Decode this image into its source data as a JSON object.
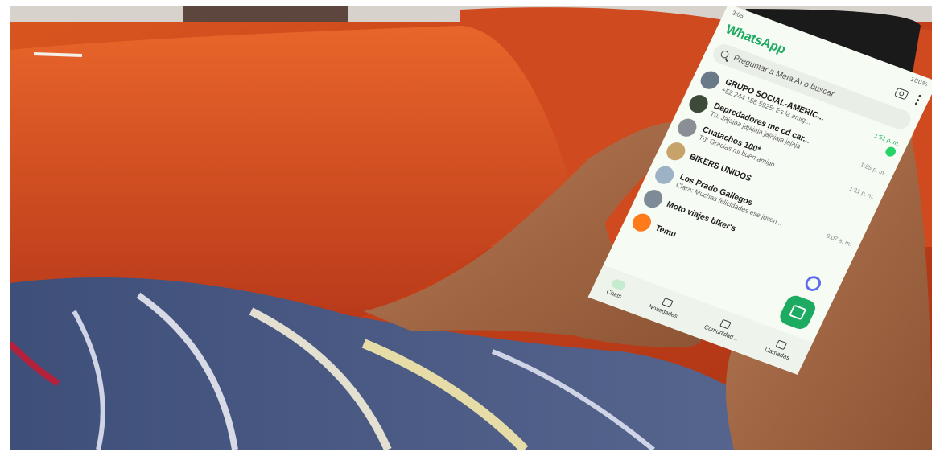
{
  "phone": {
    "statusbar": {
      "time": "3:05",
      "battery": "100%"
    },
    "app_title": "WhatsApp",
    "search_placeholder": "Preguntar a Meta AI o buscar",
    "chats": [
      {
        "name": "GRUPO SOCIAL-AMERIC...",
        "preview": "+52 244 158 5925: Es la amig...",
        "time": "1:51 p. m.",
        "unread": true,
        "avatar_color": "#6b7a88"
      },
      {
        "name": "Depredadores mc cd car...",
        "preview": "Tú: Jajajaa jajajaja jajajaja jajaja",
        "time": "1:25 p. m.",
        "unread": false,
        "avatar_color": "#3d4a3a"
      },
      {
        "name": "Cuatachos 100*",
        "preview": "Tú: Gracias mi buen amigo",
        "time": "1:11 p. m.",
        "unread": false,
        "avatar_color": "#8a8f95"
      },
      {
        "name": "BIKERS UNIDOS",
        "preview": "",
        "time": "",
        "unread": false,
        "avatar_color": "#c7a36b"
      },
      {
        "name": "Los Prado Gallegos",
        "preview": "Clara: Muchas felicidades ese joven...",
        "time": "9:07 a. m.",
        "unread": false,
        "avatar_color": "#9db2c4"
      },
      {
        "name": "Moto viajes biker's",
        "preview": "",
        "time": "",
        "unread": false,
        "avatar_color": "#7e8a96"
      },
      {
        "name": "Temu",
        "preview": "",
        "time": "",
        "unread": false,
        "avatar_color": "#ff7a1a"
      }
    ],
    "tabs": [
      {
        "label": "Chats"
      },
      {
        "label": "Novedades"
      },
      {
        "label": "Comunidad..."
      },
      {
        "label": "Llamadas"
      }
    ],
    "colors": {
      "accent": "#1daa61",
      "unread": "#25d366",
      "meta_ai": "#5a6cf0"
    }
  }
}
